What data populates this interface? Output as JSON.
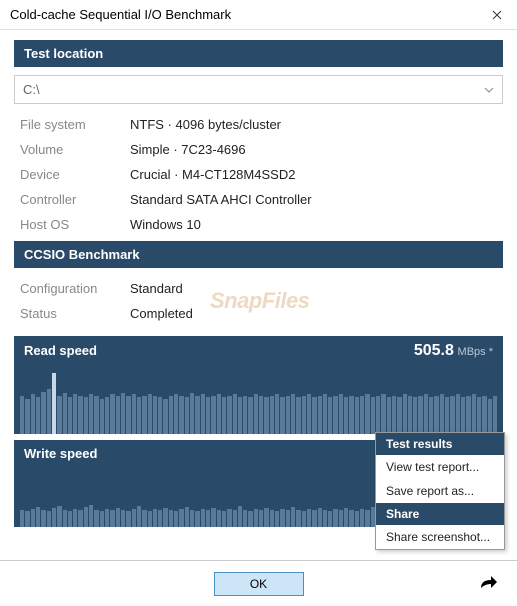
{
  "window": {
    "title": "Cold-cache Sequential I/O Benchmark"
  },
  "sections": {
    "location_header": "Test location",
    "benchmark_header": "CCSIO Benchmark",
    "read_header": "Read speed",
    "write_header": "Write speed"
  },
  "dropdown": {
    "value": "C:\\"
  },
  "location": {
    "fs_label": "File system",
    "fs_value": "NTFS  ·  4096 bytes/cluster",
    "vol_label": "Volume",
    "vol_value": "Simple  ·  7C23-4696",
    "dev_label": "Device",
    "dev_value": "Crucial  ·  M4-CT128M4SSD2",
    "ctrl_label": "Controller",
    "ctrl_value": "Standard SATA AHCI Controller",
    "os_label": "Host OS",
    "os_value": "Windows 10"
  },
  "benchmark": {
    "cfg_label": "Configuration",
    "cfg_value": "Standard",
    "status_label": "Status",
    "status_value": "Completed"
  },
  "read": {
    "value": "505.8",
    "unit": "MBps *"
  },
  "menu": {
    "results_header": "Test results",
    "view_report": "View test report...",
    "save_report": "Save report as...",
    "share_header": "Share",
    "share_screenshot": "Share screenshot..."
  },
  "buttons": {
    "ok": "OK"
  },
  "watermark": "SnapFiles",
  "chart_data": {
    "read": [
      60,
      55,
      62,
      58,
      65,
      70,
      95,
      60,
      64,
      58,
      62,
      60,
      58,
      62,
      60,
      55,
      58,
      62,
      60,
      64,
      60,
      62,
      58,
      60,
      62,
      60,
      58,
      55,
      60,
      62,
      60,
      58,
      64,
      60,
      62,
      58,
      60,
      62,
      58,
      60,
      62,
      58,
      60,
      58,
      62,
      60,
      58,
      60,
      62,
      58,
      60,
      62,
      58,
      60,
      62,
      58,
      60,
      62,
      58,
      60,
      62,
      58,
      60,
      58,
      60,
      62,
      58,
      60,
      62,
      58,
      60,
      58,
      62,
      60,
      58,
      60,
      62,
      58,
      60,
      62,
      58,
      60,
      62,
      58,
      60,
      62,
      58,
      60,
      55,
      60
    ],
    "read_highlight_index": 6,
    "write": [
      30,
      28,
      32,
      35,
      30,
      28,
      34,
      38,
      30,
      28,
      32,
      30,
      36,
      40,
      30,
      28,
      32,
      30,
      34,
      30,
      28,
      32,
      38,
      30,
      28,
      32,
      30,
      34,
      30,
      28,
      32,
      36,
      30,
      28,
      32,
      30,
      34,
      30,
      28,
      32,
      30,
      38,
      30,
      28,
      32,
      30,
      34,
      30,
      28,
      32,
      30,
      36,
      30,
      28,
      32,
      30,
      34,
      30,
      28,
      32,
      30,
      34,
      30,
      28,
      32,
      30,
      36,
      30,
      28,
      32,
      30,
      34,
      30,
      28,
      32,
      30,
      38,
      30,
      28,
      32,
      30,
      34,
      30,
      28,
      32,
      30,
      34,
      28,
      30,
      32
    ]
  }
}
